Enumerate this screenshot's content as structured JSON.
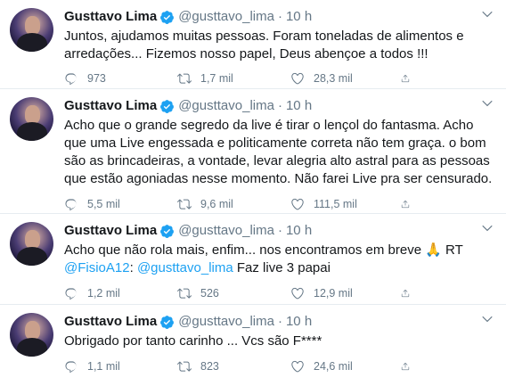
{
  "tweets": [
    {
      "author_name": "Gusttavo Lima",
      "handle": "@gusttavo_lima",
      "separator": "·",
      "time": "10 h",
      "text": "Juntos, ajudamos muitas pessoas. Foram toneladas de alimentos e arredações... Fizemos nosso papel, Deus abençoe a todos !!!",
      "replies": "973",
      "retweets": "1,7 mil",
      "likes": "28,3 mil"
    },
    {
      "author_name": "Gusttavo Lima",
      "handle": "@gusttavo_lima",
      "separator": "·",
      "time": "10 h",
      "text": "Acho que o grande segredo da live é tirar o lençol do fantasma. Acho que uma Live engessada e politicamente correta não tem graça. o bom são as brincadeiras, a vontade, levar alegria alto astral para as pessoas que estão agoniadas nesse momento. Não farei Live pra ser censurado.",
      "replies": "5,5 mil",
      "retweets": "9,6 mil",
      "likes": "111,5 mil"
    },
    {
      "author_name": "Gusttavo Lima",
      "handle": "@gusttavo_lima",
      "separator": "·",
      "time": "10 h",
      "text_before": "Acho que não rola mais, enfim... nos encontramos em breve 🙏 RT",
      "mention_1": "@FisioA12",
      "text_middle": ": ",
      "mention_2": "@gusttavo_lima",
      "text_after": " Faz live 3 papai",
      "replies": "1,2 mil",
      "retweets": "526",
      "likes": "12,9 mil"
    },
    {
      "author_name": "Gusttavo Lima",
      "handle": "@gusttavo_lima",
      "separator": "·",
      "time": "10 h",
      "text": "Obrigado por tanto carinho ... Vcs são F****",
      "replies": "1,1 mil",
      "retweets": "823",
      "likes": "24,6 mil"
    }
  ],
  "colors": {
    "accent": "#1da1f2",
    "secondary_text": "#657786",
    "divider": "#e6ecf0"
  }
}
